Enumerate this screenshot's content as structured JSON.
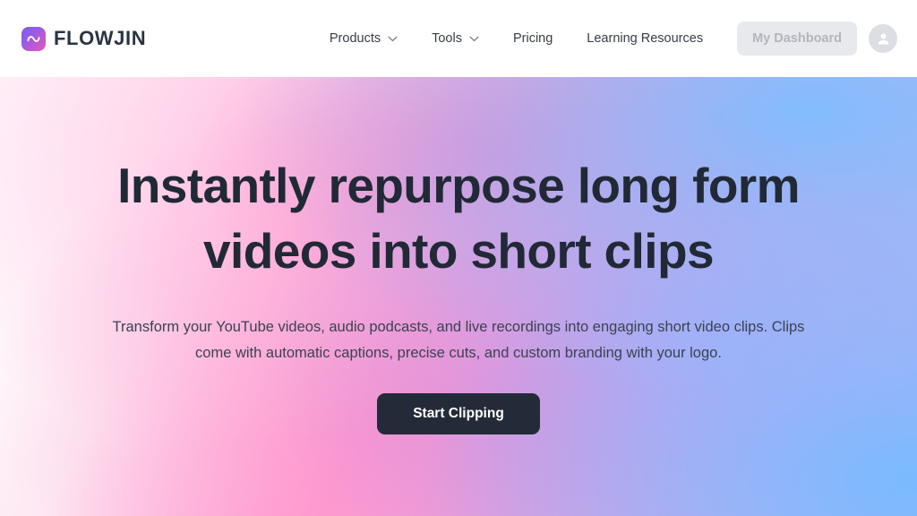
{
  "brand": {
    "name": "FLOWJIN",
    "mark_icon": "wave-tilde-icon",
    "gradient_from": "#7b5cf0",
    "gradient_to": "#e857b4"
  },
  "nav": {
    "items": [
      {
        "label": "Products",
        "has_dropdown": true,
        "icon": "chevron-down-icon"
      },
      {
        "label": "Tools",
        "has_dropdown": true,
        "icon": "chevron-down-icon"
      },
      {
        "label": "Pricing",
        "has_dropdown": false
      },
      {
        "label": "Learning Resources",
        "has_dropdown": false
      }
    ],
    "dashboard_button": "My Dashboard",
    "avatar_icon": "user-avatar-icon"
  },
  "hero": {
    "title": "Instantly repurpose long form videos into short clips",
    "subtitle": "Transform your YouTube videos, audio podcasts, and live recordings into engaging short video clips. Clips come with automatic captions, precise cuts, and custom branding with your logo.",
    "cta_label": "Start Clipping",
    "cta_color": "#242b38",
    "title_color": "#212936"
  }
}
